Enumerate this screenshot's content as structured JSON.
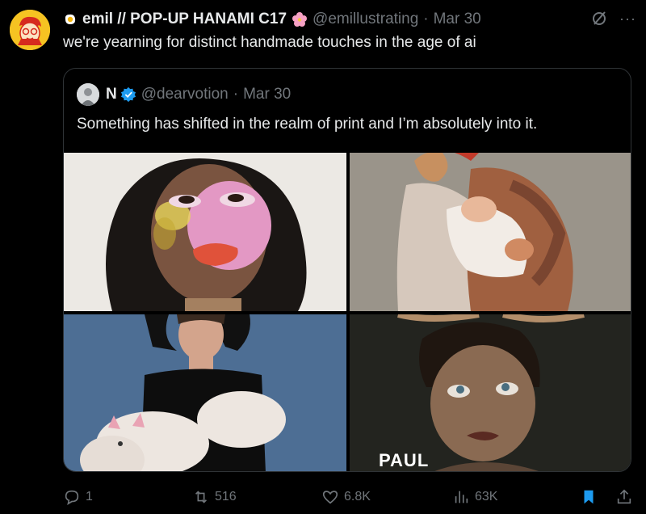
{
  "tweet": {
    "author_name": "emil // POP-UP HANAMI C17",
    "handle": "@emillustrating",
    "separator": "·",
    "date": "Mar 30",
    "text": "we're yearning for distinct handmade touches in the age of ai",
    "more_label": "···"
  },
  "quote": {
    "author_name": "N",
    "handle": "@dearvotion",
    "separator": "·",
    "date": "Mar 30",
    "text": "Something has shifted in the realm of print and I’m absolutely into it.",
    "images": [
      {
        "name": "painted-face-portrait"
      },
      {
        "name": "embrace-photo"
      },
      {
        "name": "black-dress-fur-photo"
      },
      {
        "name": "paul-poster",
        "caption": "PAUL"
      }
    ]
  },
  "actions": {
    "replies": "1",
    "reposts": "516",
    "likes": "6.8K",
    "views": "63K"
  },
  "colors": {
    "background": "#000000",
    "text": "#e7e9ea",
    "muted": "#71767b",
    "border": "#2f3336",
    "accent": "#1d9bf0"
  }
}
